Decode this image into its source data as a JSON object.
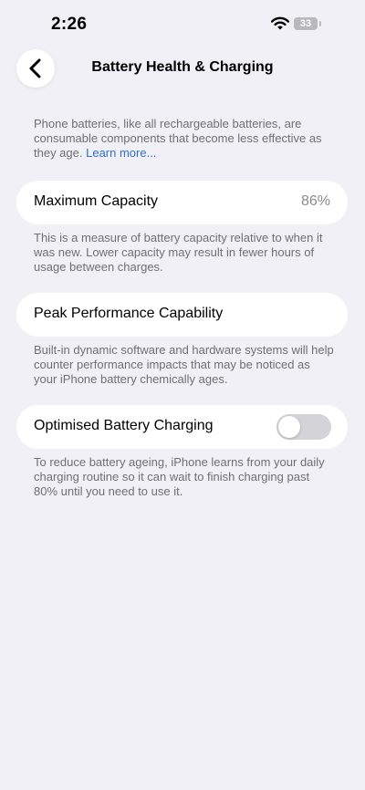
{
  "status_bar": {
    "time": "2:26",
    "battery_level": "33"
  },
  "header": {
    "title": "Battery Health & Charging",
    "back_icon": "chevron-left-icon"
  },
  "intro": {
    "text": "Phone batteries, like all rechargeable batteries, are consumable components that become less effective as they age. ",
    "link": "Learn more..."
  },
  "maximum_capacity": {
    "label": "Maximum Capacity",
    "value": "86%",
    "footnote": "This is a measure of battery capacity relative to when it was new. Lower capacity may result in fewer hours of usage between charges."
  },
  "peak_performance": {
    "label": "Peak Performance Capability",
    "footnote": "Built-in dynamic software and hardware systems will help counter performance impacts that may be noticed as your iPhone battery chemically ages."
  },
  "optimised_charging": {
    "label": "Optimised Battery Charging",
    "enabled": false,
    "footnote": "To reduce battery ageing, iPhone learns from your daily charging routine so it can wait to finish charging past 80% until you need to use it."
  },
  "colors": {
    "background": "#f1f0f6",
    "card": "#ffffff",
    "link": "#2f6fd0",
    "toggle_off": "#d3d3d8"
  }
}
